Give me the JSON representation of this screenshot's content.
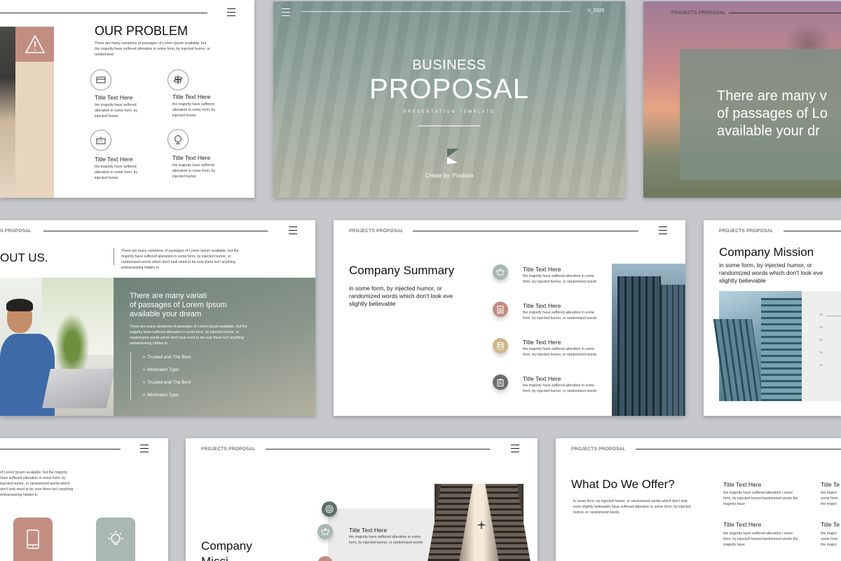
{
  "s1": {
    "title": "OUR PROBLEM",
    "desc": "There are many variations of passages of Lorem Ipsum available, but the majority have suffered alteration in some form, by injected humor, or randomized",
    "items": [
      {
        "title": "Title Text Here",
        "text": "the majority have suffered alteration in some form, by injected humor"
      },
      {
        "title": "Title Text Here",
        "text": "the majority have suffered alteration in some form, by injected humor"
      },
      {
        "title": "Title Text Here",
        "text": "the majority have suffered alteration in some form, by injected humor"
      },
      {
        "title": "Title Text Here",
        "text": "the majority have suffered alteration in some form, by injected humor"
      }
    ]
  },
  "s2": {
    "version": "V_2028",
    "line1": "BUSINESS",
    "line2": "PROPOSAL",
    "sub": "PRESENTATION TEMPLATE",
    "credit": "Create by: Pradaxa"
  },
  "s3": {
    "tag": "PROJECTS PROPOSAL",
    "quote": [
      "There are many v",
      "of passages of Lo",
      "available your dr"
    ]
  },
  "s4": {
    "tag": "S PROPOSAL",
    "title": "OUT US.",
    "desc": "There are many variations of passages of Lorem Ipsum available, but the majority have suffered alteration in some form, by injected humor, or randomized words which don't look need to be sure there isn't anything embarrassing hidden in",
    "quote": [
      "There are many variati",
      "of passages of Lorem Ipsum",
      "available your dream"
    ],
    "para": "There are many variations of passages of Lorem Ipsum available, but the majority have suffered alteration in some form, by injected humor, or randomized words which don't look need to be sure there isn't anything embarrassing hidden in",
    "bullets": [
      "➢ Trusted and The Best",
      "➢ Minimalist Type",
      "➢ Trusted and The Best",
      "➢ Minimalist Type"
    ]
  },
  "s5": {
    "tag": "PROJECTS PROPOSAL",
    "title": "Company Summary",
    "desc": "in some form, by injected humor, or randomized words which don't look eve slightly believable",
    "items": [
      {
        "title": "Title Text Here",
        "text": "the majority have suffered alteration in some form, by injected humor, or randomized words",
        "color": "#a9b8b1"
      },
      {
        "title": "Title Text Here",
        "text": "the majority have suffered alteration in some form, by injected humor, or randomized words",
        "color": "#c28e82"
      },
      {
        "title": "Title Text Here",
        "text": "the majority have suffered alteration in some form, by injected humor, or randomized words",
        "color": "#cfb78a"
      },
      {
        "title": "Title Text Here",
        "text": "the majority have suffered alteration in some form, by injected humor, or randomized words",
        "color": "#6c6c6c"
      }
    ]
  },
  "s6": {
    "tag": "PROJECTS PROPOSAL",
    "title": "Company Mission",
    "desc": "in some form, by injected humor, or randomized words which don't look eve slightly believable",
    "nums": [
      "05",
      "04",
      "03",
      "02",
      "01"
    ]
  },
  "s7": {
    "desc": "of Lorem Ipsum available, but the majority have suffered alteration in some form, by injected humor, or randomized words which don't look need to be sure there isn't anything embarrassing hidden in"
  },
  "s8": {
    "tag": "PROJECTS PROPOSAL",
    "title1": "Company",
    "title2": "Missi",
    "item_title": "Title Text Here",
    "item_text": "the majority have suffered alteration in some form, by injected humor, or randomized words"
  },
  "s9": {
    "tag": "PROJECTS PROPOSAL",
    "title": "What Do We Offer?",
    "desc": "in some form, by injected humor, or randomized words which don't look even slightly believable have suffered alteration in some form, by injected humor, or randomized words",
    "items": [
      {
        "title": "Title Text Here",
        "text": "the majority have suffered alteration i some form, by injected humor/randomized words the majority have"
      },
      {
        "title": "Title Te",
        "text": "the majori some form the majori"
      },
      {
        "title": "Title Text Here",
        "text": "the majority have suffered alteration i some form, by injected humor/randomized words the majority have"
      },
      {
        "title": "Title Te",
        "text": "the majori some form the majori"
      }
    ]
  },
  "colors": {
    "sage": "#7d8f84",
    "terracotta": "#c28e82",
    "gold": "#cfb78a",
    "grey": "#6c6c6c",
    "beige": "#e6d3bb"
  }
}
